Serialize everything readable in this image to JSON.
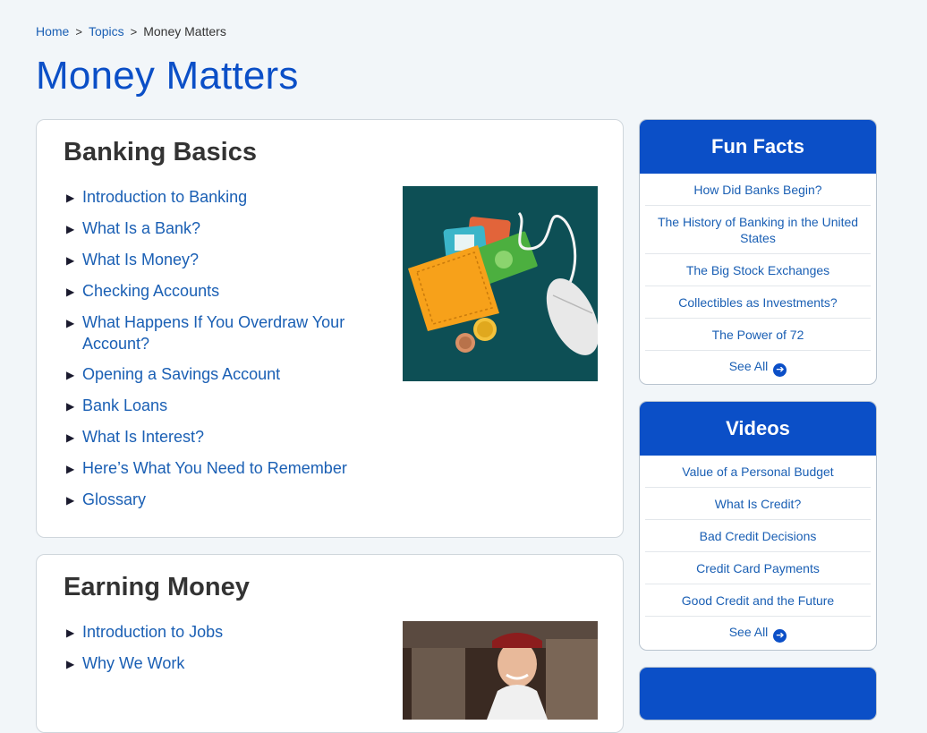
{
  "breadcrumb": {
    "home": "Home",
    "topics": "Topics",
    "current": "Money Matters",
    "separator": ">"
  },
  "page_title": "Money Matters",
  "sections": [
    {
      "title": "Banking Basics",
      "items": [
        "Introduction to Banking",
        "What Is a Bank?",
        "What Is Money?",
        "Checking Accounts",
        "What Happens If You Overdraw Your Account?",
        "Opening a Savings Account",
        "Bank Loans",
        "What Is Interest?",
        "Here’s What You Need to Remember",
        "Glossary"
      ]
    },
    {
      "title": "Earning Money",
      "items": [
        "Introduction to Jobs",
        "Why We Work"
      ]
    }
  ],
  "sidebar": [
    {
      "title": "Fun Facts",
      "items": [
        "How Did Banks Begin?",
        "The History of Banking in the United States",
        "The Big Stock Exchanges",
        "Collectibles as Investments?",
        "The Power of 72"
      ],
      "see_all": "See All"
    },
    {
      "title": "Videos",
      "items": [
        "Value of a Personal Budget",
        "What Is Credit?",
        "Bad Credit Decisions",
        "Credit Card Payments",
        "Good Credit and the Future"
      ],
      "see_all": "See All"
    }
  ],
  "colors": {
    "brand_blue": "#0b4fc7",
    "link_blue": "#1a5fb4",
    "page_bg": "#f2f6f9"
  }
}
